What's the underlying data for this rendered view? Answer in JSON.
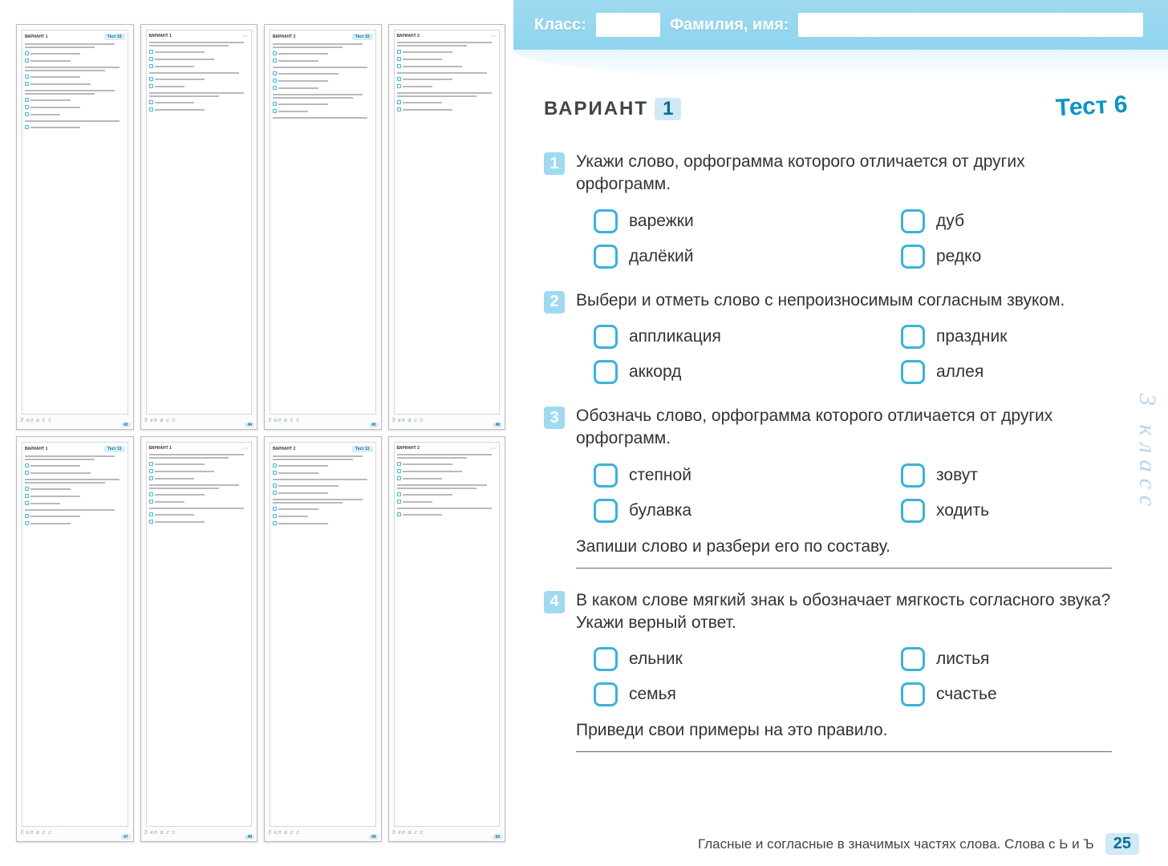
{
  "header": {
    "class_label": "Класс:",
    "name_label": "Фамилия, имя:"
  },
  "page_title": {
    "variant_label": "ВАРИАНТ",
    "variant_number": "1",
    "test_label": "Тест 6"
  },
  "questions": [
    {
      "num": "1",
      "text": "Укажи слово, орфограмма которого отличается от других орфограмм.",
      "options": [
        "варежки",
        "дуб",
        "далёкий",
        "редко"
      ]
    },
    {
      "num": "2",
      "text": "Выбери и отметь слово с непроизносимым согласным звуком.",
      "options": [
        "аппликация",
        "праздник",
        "аккорд",
        "аллея"
      ]
    },
    {
      "num": "3",
      "text": "Обозначь слово, орфограмма которого отличается от других орфограмм.",
      "options": [
        "степной",
        "зовут",
        "булавка",
        "ходить"
      ],
      "sub": "Запиши слово и разбери его по составу."
    },
    {
      "num": "4",
      "text": "В каком слове мягкий знак ь обозначает мягкость согласного звука? Укажи верный ответ.",
      "options": [
        "ельник",
        "листья",
        "семья",
        "счастье"
      ],
      "sub": "Приведи свои примеры на это правило."
    }
  ],
  "footer": {
    "text": "Гласные и согласные в значимых частях слова. Слова с Ь и Ъ",
    "page": "25"
  },
  "side_scribble": "3 класс",
  "thumbs": [
    {
      "variant": "ВАРИАНТ 1",
      "test": "Тест 10",
      "page": "43",
      "scribble": "3 кл а с с"
    },
    {
      "variant": "ВАРИАНТ 1",
      "test": "",
      "page": "44",
      "scribble": "3 кл а с с"
    },
    {
      "variant": "ВАРИАНТ 2",
      "test": "Тест 10",
      "page": "45",
      "scribble": "3 кл а с с"
    },
    {
      "variant": "ВАРИАНТ 2",
      "test": "",
      "page": "46",
      "scribble": "3 кл а с с"
    },
    {
      "variant": "ВАРИАНТ 1",
      "test": "Тест 11",
      "page": "47",
      "scribble": "3 кл а с с"
    },
    {
      "variant": "ВАРИАНТ 1",
      "test": "",
      "page": "48",
      "scribble": "3 кл а с с"
    },
    {
      "variant": "ВАРИАНТ 2",
      "test": "Тест 11",
      "page": "49",
      "scribble": "3 кл а с с"
    },
    {
      "variant": "ВАРИАНТ 2",
      "test": "",
      "page": "50",
      "scribble": "3 кл а с с"
    }
  ]
}
